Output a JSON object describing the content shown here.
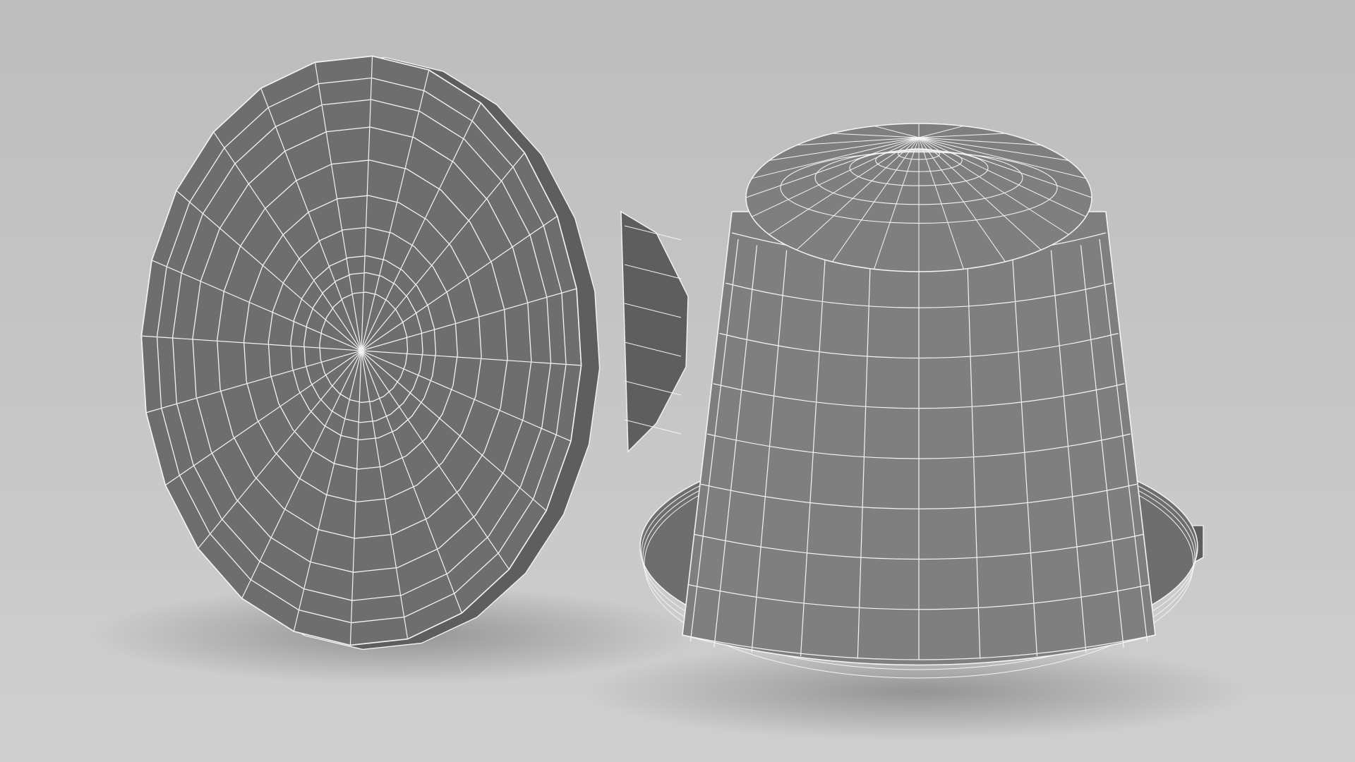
{
  "scene": {
    "background_top": "#bdbdbd",
    "background_bottom": "#cfcfcf",
    "mesh_fill": "#6e6e6e",
    "mesh_fill_light": "#7f7f7f",
    "mesh_fill_dark": "#5e5e5e",
    "wire_color": "#f4f4f4",
    "objects": [
      {
        "name": "capsule-bottom-view",
        "radial_segments": 24,
        "rings": 9
      },
      {
        "name": "capsule-side-view",
        "radial_segments": 24,
        "rows": 8
      }
    ]
  }
}
